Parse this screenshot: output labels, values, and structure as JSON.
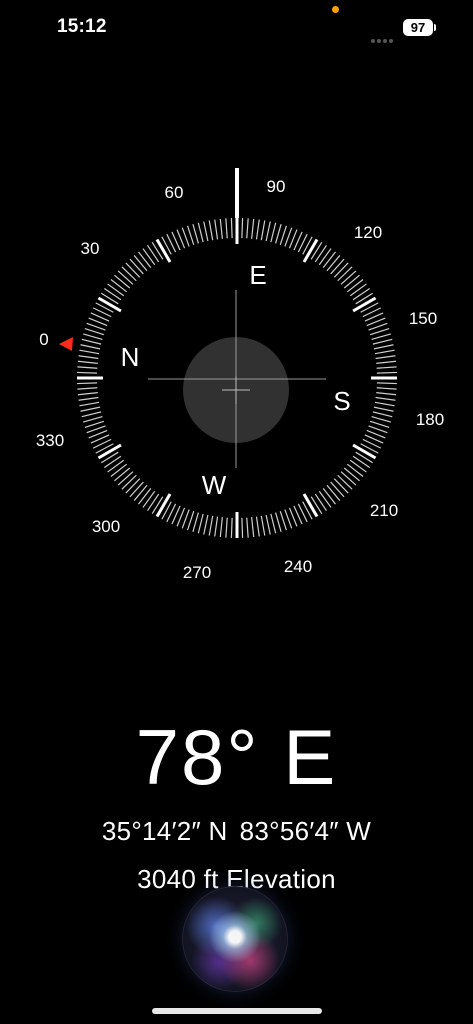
{
  "status_bar": {
    "time": "15:12",
    "battery": "97",
    "colors": {
      "privacy_indicator": "#ff9f0a"
    }
  },
  "compass": {
    "degree_labels": [
      "0",
      "30",
      "60",
      "90",
      "120",
      "150",
      "180",
      "210",
      "240",
      "270",
      "300",
      "330"
    ],
    "cardinal_labels": {
      "north": "N",
      "east": "E",
      "south": "S",
      "west": "W"
    },
    "heading_marker": "white-line",
    "bearing_marker_icon": "red-triangle-icon",
    "colors": {
      "marker": "#ff2a1a"
    }
  },
  "readout": {
    "heading": "78° E",
    "latitude": "35°14′2″ N",
    "longitude": "83°56′4″ W",
    "elevation": "3040 ft Elevation"
  },
  "assistant": {
    "icon": "siri-orb-icon"
  }
}
